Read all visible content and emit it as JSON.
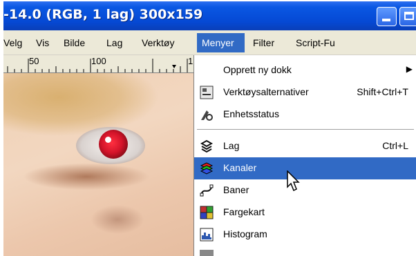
{
  "window": {
    "title": "-14.0 (RGB, 1 lag) 300x159",
    "buttons": [
      {
        "icon": "minimize-icon"
      },
      {
        "icon": "maximize-icon"
      }
    ]
  },
  "menubar": {
    "items": [
      {
        "label": "Velg"
      },
      {
        "label": "Vis"
      },
      {
        "label": "Bilde"
      },
      {
        "label": "Lag"
      },
      {
        "label": "Verktøy"
      },
      {
        "label": "Menyer"
      },
      {
        "label": "Filter"
      },
      {
        "label": "Script-Fu"
      }
    ],
    "active": "Menyer"
  },
  "ruler": {
    "ticks": [
      "50",
      "100",
      "1"
    ]
  },
  "menu": {
    "items": [
      {
        "label": "Opprett ny dokk",
        "shortcut": "",
        "submenu": true,
        "icon": ""
      },
      {
        "label": "Verktøysalternativer",
        "shortcut": "Shift+Ctrl+T",
        "submenu": false,
        "icon": "tool-options-icon"
      },
      {
        "label": "Enhetsstatus",
        "shortcut": "",
        "submenu": false,
        "icon": "device-status-icon"
      },
      {
        "label": "Lag",
        "shortcut": "Ctrl+L",
        "submenu": false,
        "icon": "layers-icon"
      },
      {
        "label": "Kanaler",
        "shortcut": "",
        "submenu": false,
        "icon": "channels-icon",
        "highlighted": true
      },
      {
        "label": "Baner",
        "shortcut": "",
        "submenu": false,
        "icon": "paths-icon"
      },
      {
        "label": "Fargekart",
        "shortcut": "",
        "submenu": false,
        "icon": "colormap-icon"
      },
      {
        "label": "Histogram",
        "shortcut": "",
        "submenu": false,
        "icon": "histogram-icon"
      }
    ]
  },
  "colors": {
    "title_blue": "#0549d4",
    "menu_highlight": "#316ac5",
    "menubar_bg": "#ece9d8",
    "red_eye": "#d4142a"
  }
}
